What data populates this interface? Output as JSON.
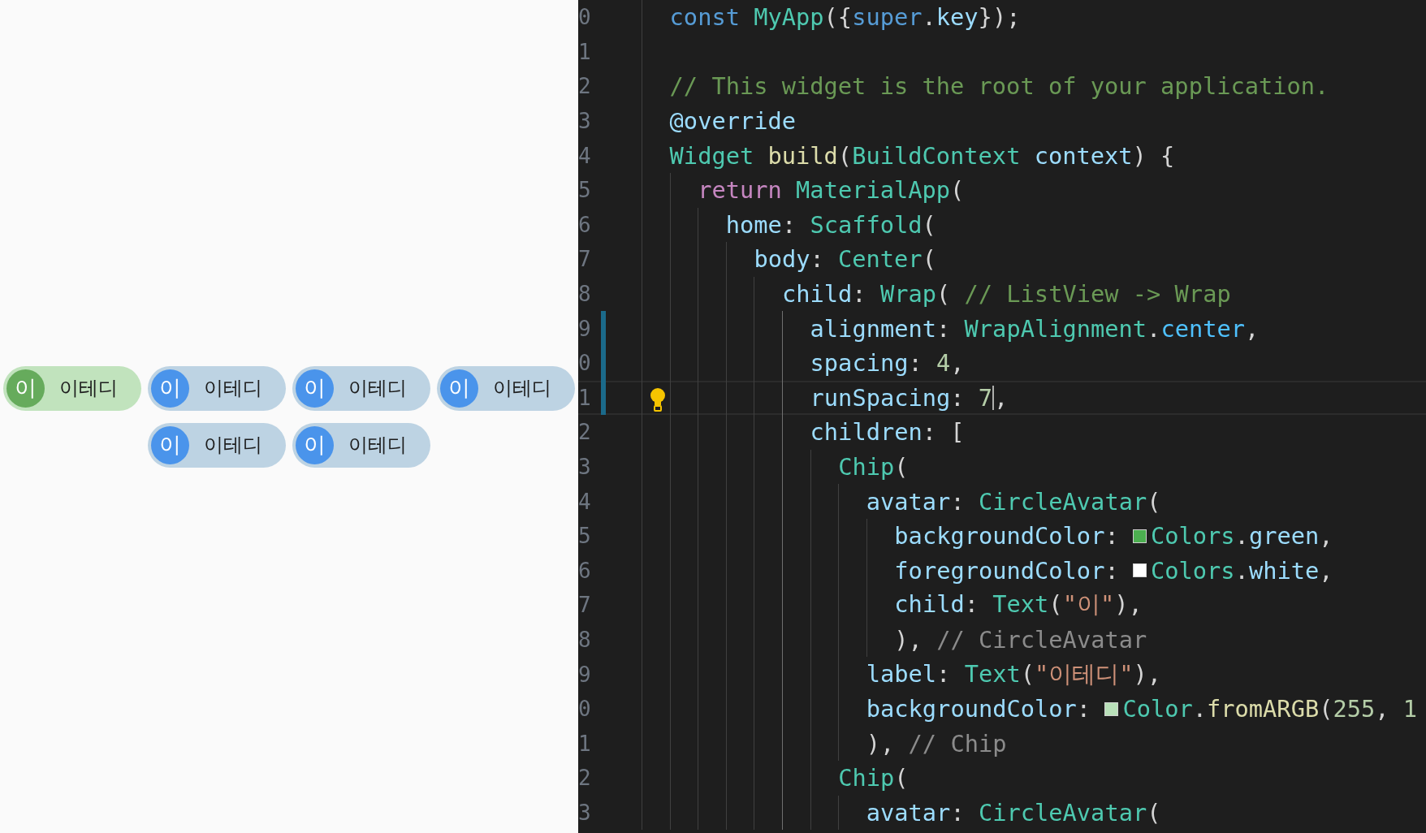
{
  "preview": {
    "chips": [
      {
        "avatar": {
          "text": "이",
          "color": "#66ab5c"
        },
        "label": "이테디",
        "color": "#c1e3bd"
      },
      {
        "avatar": {
          "text": "이",
          "color": "#4a94eb"
        },
        "label": "이테디",
        "color": "#bdd3e3"
      },
      {
        "avatar": {
          "text": "이",
          "color": "#4a94eb"
        },
        "label": "이테디",
        "color": "#bdd3e3"
      },
      {
        "avatar": {
          "text": "이",
          "color": "#4a94eb"
        },
        "label": "이테디",
        "color": "#bdd3e3"
      },
      {
        "avatar": {
          "text": "이",
          "color": "#4a94eb"
        },
        "label": "이테디",
        "color": "#bdd3e3"
      },
      {
        "avatar": {
          "text": "이",
          "color": "#4a94eb"
        },
        "label": "이테디",
        "color": "#bdd3e3"
      }
    ]
  },
  "editor": {
    "lines": [
      {
        "number": "0",
        "modified": false,
        "current": false,
        "hint": false,
        "tokens": [
          {
            "kind": "kw",
            "text": "const "
          },
          {
            "kind": "type",
            "text": "MyApp"
          },
          {
            "kind": "p",
            "text": "({"
          },
          {
            "kind": "kw",
            "text": "super"
          },
          {
            "kind": "p",
            "text": "."
          },
          {
            "kind": "prop",
            "text": "key"
          },
          {
            "kind": "p",
            "text": "});"
          }
        ]
      },
      {
        "number": "1",
        "modified": false,
        "current": false,
        "hint": false
      },
      {
        "number": "2",
        "modified": false,
        "current": false,
        "hint": false,
        "tokens": [
          {
            "kind": "com",
            "text": "// This widget is the root of your application."
          }
        ]
      },
      {
        "number": "3",
        "modified": false,
        "current": false,
        "hint": false,
        "tokens": [
          {
            "kind": "prop",
            "text": "@override"
          }
        ]
      },
      {
        "number": "4",
        "modified": false,
        "current": false,
        "hint": false,
        "tokens": [
          {
            "kind": "type",
            "text": "Widget "
          },
          {
            "kind": "fn",
            "text": "build"
          },
          {
            "kind": "p",
            "text": "("
          },
          {
            "kind": "type",
            "text": "BuildContext "
          },
          {
            "kind": "prop",
            "text": "context"
          },
          {
            "kind": "p",
            "text": ") {"
          }
        ],
        "children": [
          {
            "number": "5",
            "modified": false,
            "current": false,
            "hint": false,
            "tokens": [
              {
                "kind": "ctrl",
                "text": "return "
              },
              {
                "kind": "type",
                "text": "MaterialApp"
              },
              {
                "kind": "p",
                "text": "("
              }
            ],
            "children": [
              {
                "number": "6",
                "modified": false,
                "current": false,
                "hint": false,
                "tokens": [
                  {
                    "kind": "prop",
                    "text": "home"
                  },
                  {
                    "kind": "p",
                    "text": ": "
                  },
                  {
                    "kind": "type",
                    "text": "Scaffold"
                  },
                  {
                    "kind": "p",
                    "text": "("
                  }
                ],
                "children": [
                  {
                    "number": "7",
                    "modified": false,
                    "current": false,
                    "hint": false,
                    "tokens": [
                      {
                        "kind": "prop",
                        "text": "body"
                      },
                      {
                        "kind": "p",
                        "text": ": "
                      },
                      {
                        "kind": "type",
                        "text": "Center"
                      },
                      {
                        "kind": "p",
                        "text": "("
                      }
                    ],
                    "children": [
                      {
                        "number": "8",
                        "modified": false,
                        "current": false,
                        "hint": false,
                        "tokens": [
                          {
                            "kind": "prop",
                            "text": "child"
                          },
                          {
                            "kind": "p",
                            "text": ": "
                          },
                          {
                            "kind": "type",
                            "text": "Wrap"
                          },
                          {
                            "kind": "p",
                            "text": "( "
                          },
                          {
                            "kind": "com",
                            "text": "// ListView -> Wrap"
                          }
                        ],
                        "children": [
                          {
                            "number": "9",
                            "modified": true,
                            "current": false,
                            "hint": false,
                            "tokens": [
                              {
                                "kind": "prop",
                                "text": "alignment"
                              },
                              {
                                "kind": "p",
                                "text": ": "
                              },
                              {
                                "kind": "type",
                                "text": "WrapAlignment"
                              },
                              {
                                "kind": "p",
                                "text": "."
                              },
                              {
                                "kind": "enum",
                                "text": "center"
                              },
                              {
                                "kind": "p",
                                "text": ","
                              }
                            ]
                          },
                          {
                            "number": "0",
                            "modified": true,
                            "current": false,
                            "hint": false,
                            "tokens": [
                              {
                                "kind": "prop",
                                "text": "spacing"
                              },
                              {
                                "kind": "p",
                                "text": ": "
                              },
                              {
                                "kind": "num",
                                "text": "4"
                              },
                              {
                                "kind": "p",
                                "text": ","
                              }
                            ]
                          },
                          {
                            "number": "1",
                            "modified": true,
                            "current": true,
                            "hint": true,
                            "tokens": [
                              {
                                "kind": "prop",
                                "text": "runSpacing"
                              },
                              {
                                "kind": "p",
                                "text": ": "
                              },
                              {
                                "kind": "num",
                                "text": "7"
                              },
                              {
                                "kind": "cursor"
                              },
                              {
                                "kind": "p",
                                "text": ","
                              }
                            ]
                          },
                          {
                            "number": "2",
                            "modified": false,
                            "current": false,
                            "hint": false,
                            "tokens": [
                              {
                                "kind": "prop",
                                "text": "children"
                              },
                              {
                                "kind": "p",
                                "text": ": ["
                              }
                            ],
                            "children": [
                              {
                                "number": "3",
                                "modified": false,
                                "current": false,
                                "hint": false,
                                "tokens": [
                                  {
                                    "kind": "type",
                                    "text": "Chip"
                                  },
                                  {
                                    "kind": "p",
                                    "text": "("
                                  }
                                ],
                                "children": [
                                  {
                                    "number": "4",
                                    "modified": false,
                                    "current": false,
                                    "hint": false,
                                    "tokens": [
                                      {
                                        "kind": "prop",
                                        "text": "avatar"
                                      },
                                      {
                                        "kind": "p",
                                        "text": ": "
                                      },
                                      {
                                        "kind": "type",
                                        "text": "CircleAvatar"
                                      },
                                      {
                                        "kind": "p",
                                        "text": "("
                                      }
                                    ],
                                    "children": [
                                      {
                                        "number": "5",
                                        "modified": false,
                                        "current": false,
                                        "hint": false,
                                        "tokens": [
                                          {
                                            "kind": "prop",
                                            "text": "backgroundColor"
                                          },
                                          {
                                            "kind": "p",
                                            "text": ": "
                                          },
                                          {
                                            "kind": "swatch",
                                            "color": "#4caf50"
                                          },
                                          {
                                            "kind": "type",
                                            "text": "Colors"
                                          },
                                          {
                                            "kind": "p",
                                            "text": "."
                                          },
                                          {
                                            "kind": "prop",
                                            "text": "green"
                                          },
                                          {
                                            "kind": "p",
                                            "text": ","
                                          }
                                        ]
                                      },
                                      {
                                        "number": "6",
                                        "modified": false,
                                        "current": false,
                                        "hint": false,
                                        "tokens": [
                                          {
                                            "kind": "prop",
                                            "text": "foregroundColor"
                                          },
                                          {
                                            "kind": "p",
                                            "text": ": "
                                          },
                                          {
                                            "kind": "swatch",
                                            "color": "#ffffff"
                                          },
                                          {
                                            "kind": "type",
                                            "text": "Colors"
                                          },
                                          {
                                            "kind": "p",
                                            "text": "."
                                          },
                                          {
                                            "kind": "prop",
                                            "text": "white"
                                          },
                                          {
                                            "kind": "p",
                                            "text": ","
                                          }
                                        ]
                                      },
                                      {
                                        "number": "7",
                                        "modified": false,
                                        "current": false,
                                        "hint": false,
                                        "tokens": [
                                          {
                                            "kind": "prop",
                                            "text": "child"
                                          },
                                          {
                                            "kind": "p",
                                            "text": ": "
                                          },
                                          {
                                            "kind": "type",
                                            "text": "Text"
                                          },
                                          {
                                            "kind": "p",
                                            "text": "("
                                          },
                                          {
                                            "kind": "str",
                                            "text": "\"이\""
                                          },
                                          {
                                            "kind": "p",
                                            "text": "),"
                                          }
                                        ]
                                      },
                                      {
                                        "number": "8",
                                        "modified": false,
                                        "current": false,
                                        "hint": false,
                                        "tokens": [
                                          {
                                            "kind": "p",
                                            "text": "), "
                                          },
                                          {
                                            "kind": "gcom",
                                            "text": "// CircleAvatar"
                                          }
                                        ]
                                      }
                                    ]
                                  },
                                  {
                                    "number": "9",
                                    "modified": false,
                                    "current": false,
                                    "hint": false,
                                    "tokens": [
                                      {
                                        "kind": "prop",
                                        "text": "label"
                                      },
                                      {
                                        "kind": "p",
                                        "text": ": "
                                      },
                                      {
                                        "kind": "type",
                                        "text": "Text"
                                      },
                                      {
                                        "kind": "p",
                                        "text": "("
                                      },
                                      {
                                        "kind": "str",
                                        "text": "\"이테디\""
                                      },
                                      {
                                        "kind": "p",
                                        "text": "),"
                                      }
                                    ]
                                  },
                                  {
                                    "number": "0",
                                    "modified": false,
                                    "current": false,
                                    "hint": false,
                                    "tokens": [
                                      {
                                        "kind": "prop",
                                        "text": "backgroundColor"
                                      },
                                      {
                                        "kind": "p",
                                        "text": ": "
                                      },
                                      {
                                        "kind": "swatch",
                                        "color": "#b9e0b9"
                                      },
                                      {
                                        "kind": "type",
                                        "text": "Color"
                                      },
                                      {
                                        "kind": "p",
                                        "text": "."
                                      },
                                      {
                                        "kind": "fn",
                                        "text": "fromARGB"
                                      },
                                      {
                                        "kind": "p",
                                        "text": "("
                                      },
                                      {
                                        "kind": "num",
                                        "text": "255"
                                      },
                                      {
                                        "kind": "p",
                                        "text": ", "
                                      },
                                      {
                                        "kind": "num",
                                        "text": "1"
                                      }
                                    ]
                                  },
                                  {
                                    "number": "1",
                                    "modified": false,
                                    "current": false,
                                    "hint": false,
                                    "tokens": [
                                      {
                                        "kind": "p",
                                        "text": "), "
                                      },
                                      {
                                        "kind": "gcom",
                                        "text": "// Chip"
                                      }
                                    ]
                                  }
                                ]
                              },
                              {
                                "number": "2",
                                "modified": false,
                                "current": false,
                                "hint": false,
                                "tokens": [
                                  {
                                    "kind": "type",
                                    "text": "Chip"
                                  },
                                  {
                                    "kind": "p",
                                    "text": "("
                                  }
                                ],
                                "children": [
                                  {
                                    "number": "3",
                                    "modified": false,
                                    "current": false,
                                    "hint": false,
                                    "tokens": [
                                      {
                                        "kind": "prop",
                                        "text": "avatar"
                                      },
                                      {
                                        "kind": "p",
                                        "text": ": "
                                      },
                                      {
                                        "kind": "type",
                                        "text": "CircleAvatar"
                                      },
                                      {
                                        "kind": "p",
                                        "text": "("
                                      }
                                    ]
                                  }
                                ]
                              }
                            ]
                          }
                        ]
                      }
                    ]
                  }
                ]
              }
            ]
          }
        ]
      }
    ]
  }
}
